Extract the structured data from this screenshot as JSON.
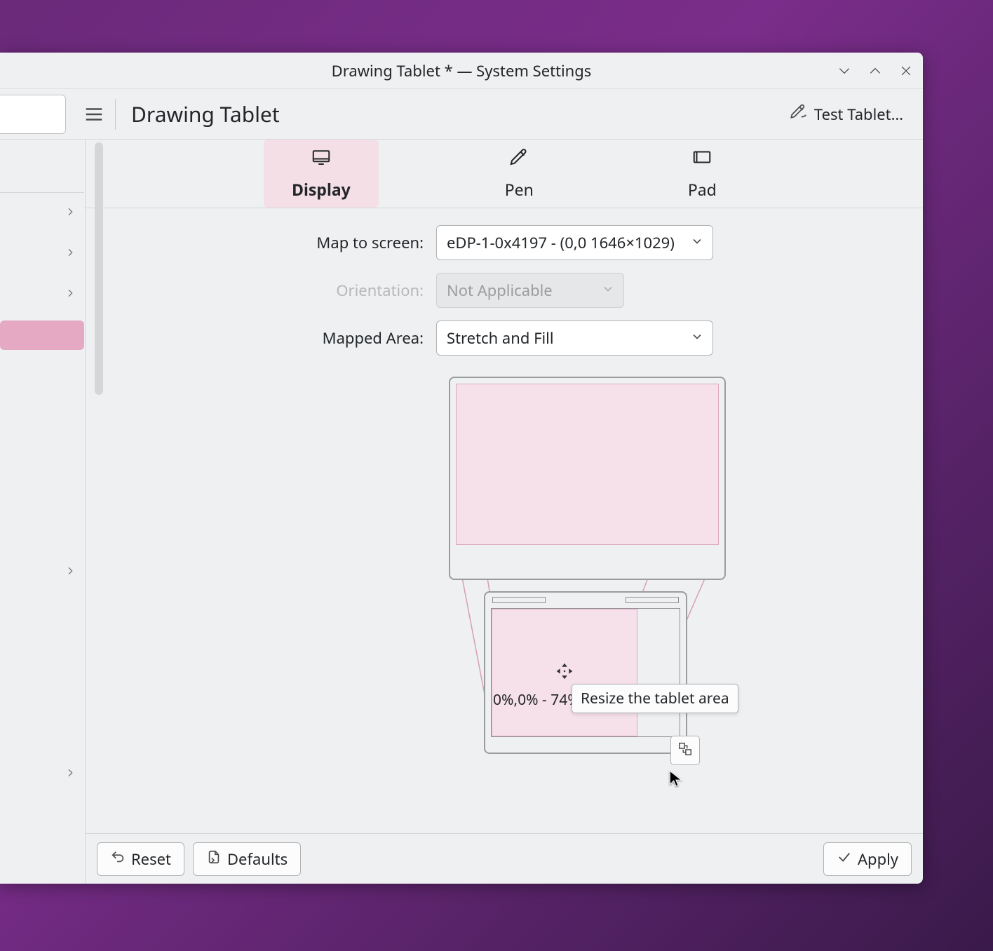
{
  "window": {
    "title": "Drawing Tablet * — System Settings"
  },
  "header": {
    "page_title": "Drawing Tablet",
    "test_tablet": "Test Tablet…"
  },
  "tabs": {
    "display": "Display",
    "pen": "Pen",
    "pad": "Pad"
  },
  "form": {
    "map_to_screen_label": "Map to screen:",
    "map_to_screen_value": "eDP-1-0x4197 - (0,0 1646×1029)",
    "orientation_label": "Orientation:",
    "orientation_value": "Not Applicable",
    "mapped_area_label": "Mapped Area:",
    "mapped_area_value": "Stretch and Fill"
  },
  "preview": {
    "area_coords": "0%,0% - 74%×100%",
    "tooltip": "Resize the tablet area"
  },
  "footer": {
    "reset": "Reset",
    "defaults": "Defaults",
    "apply": "Apply"
  }
}
